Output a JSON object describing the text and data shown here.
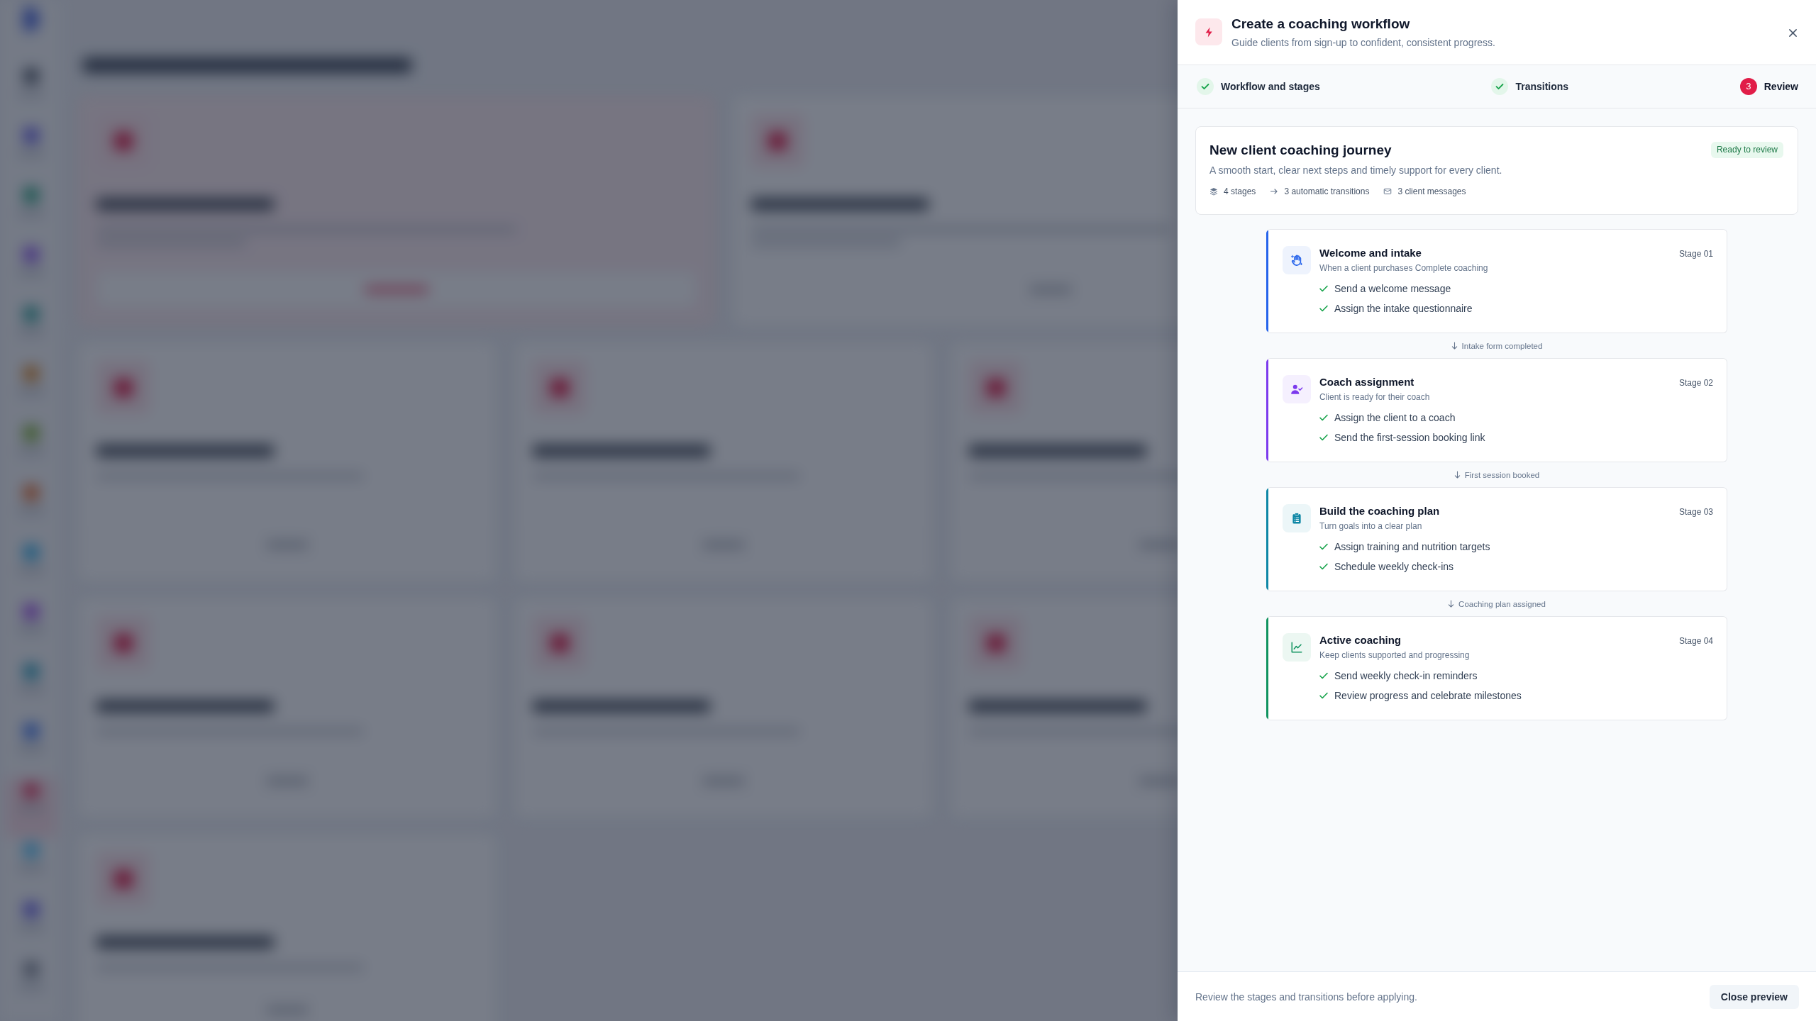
{
  "panel": {
    "title": "Create a coaching workflow",
    "subtitle": "Guide clients from sign-up to confident, consistent progress."
  },
  "steps": [
    {
      "label": "Workflow and stages",
      "completed": true,
      "selected": false
    },
    {
      "label": "Transitions",
      "completed": true,
      "selected": false
    },
    {
      "label": "Review",
      "number": "3",
      "completed": false,
      "selected": true
    }
  ],
  "summary": {
    "title": "New client coaching journey",
    "badge": "Ready to review",
    "description": "A smooth start, clear next steps and timely support for every client.",
    "stats": [
      {
        "kind": "stages",
        "text": "4 stages"
      },
      {
        "kind": "transitions",
        "text": "3 automatic transitions"
      },
      {
        "kind": "messages",
        "text": "3 client messages"
      }
    ]
  },
  "flow": [
    {
      "kind": "stage",
      "title": "Welcome and intake",
      "trigger": "When a client purchases Complete coaching",
      "label": "Stage 01",
      "color": "#2563eb",
      "tasks": [
        {
          "text": "Send a welcome message",
          "checked": true
        },
        {
          "text": "Assign the intake questionnaire",
          "checked": true
        }
      ]
    },
    {
      "kind": "transition",
      "label": "Intake form completed"
    },
    {
      "kind": "stage",
      "title": "Coach assignment",
      "trigger": "Client is ready for their coach",
      "label": "Stage 02",
      "color": "#7c3aed",
      "tasks": [
        {
          "text": "Assign the client to a coach",
          "checked": true
        },
        {
          "text": "Send the first-session booking link",
          "checked": true
        }
      ]
    },
    {
      "kind": "transition",
      "label": "First session booked"
    },
    {
      "kind": "stage",
      "title": "Build the coaching plan",
      "trigger": "Turn goals into a clear plan",
      "label": "Stage 03",
      "color": "#0e87a6",
      "tasks": [
        {
          "text": "Assign training and nutrition targets",
          "checked": true
        },
        {
          "text": "Schedule weekly check-ins",
          "checked": true
        }
      ]
    },
    {
      "kind": "transition",
      "label": "Coaching plan assigned"
    },
    {
      "kind": "stage",
      "title": "Active coaching",
      "trigger": "Keep clients supported and progressing",
      "label": "Stage 04",
      "color": "#10935f",
      "tasks": [
        {
          "text": "Send weekly check-in reminders",
          "checked": true
        },
        {
          "text": "Review progress and celebrate milestones",
          "checked": true
        }
      ]
    }
  ],
  "footer": {
    "note": "Review the stages and transitions before applying.",
    "button": "Close preview"
  }
}
